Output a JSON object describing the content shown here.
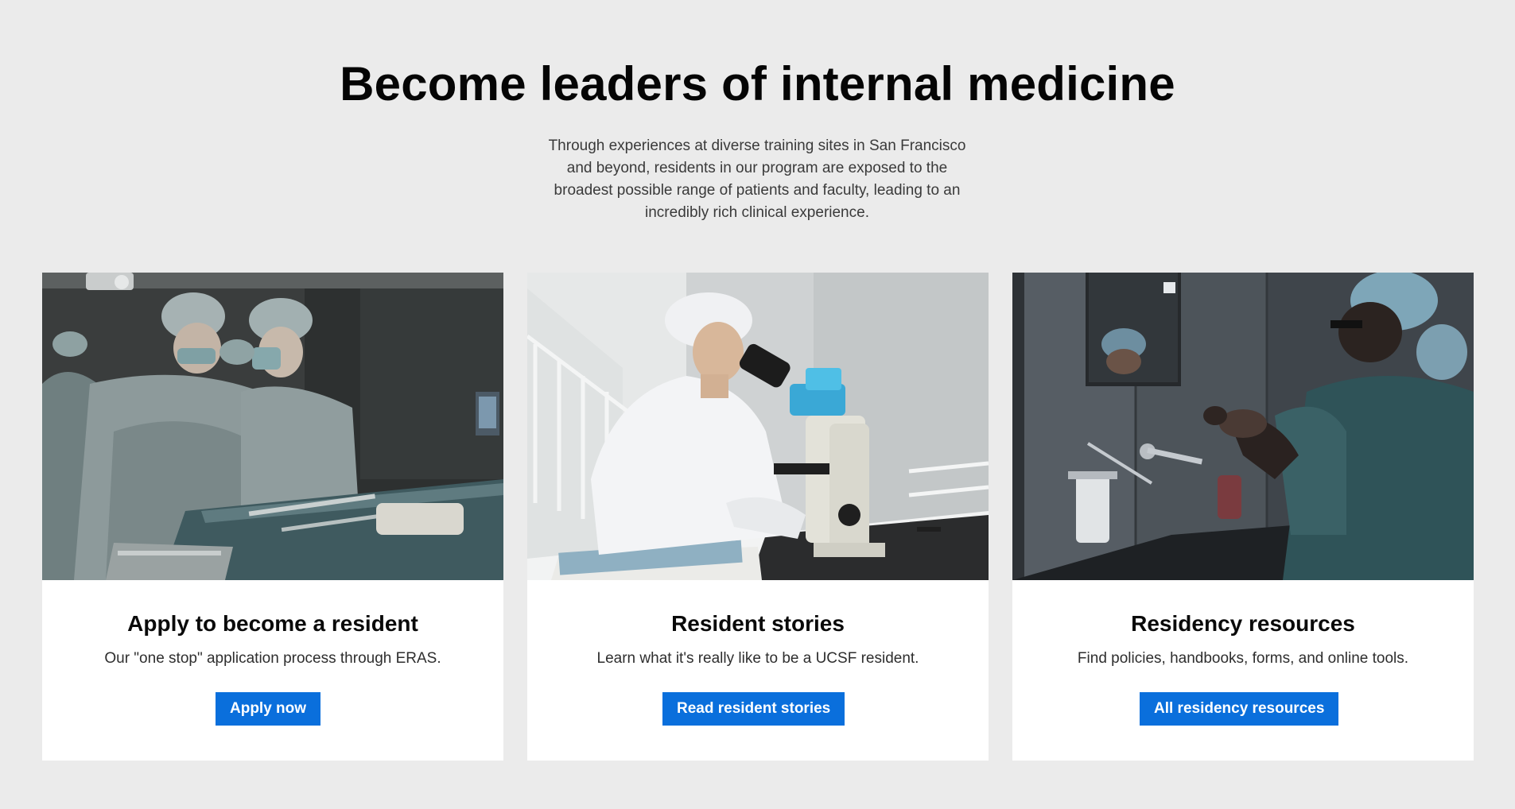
{
  "hero": {
    "title": "Become leaders of internal medicine",
    "intro": "Through experiences at diverse training sites in San Francisco and beyond, residents in our program are exposed to the broadest possible range of patients and faculty, leading to an incredibly rich clinical experience."
  },
  "cards": [
    {
      "title": "Apply to become a resident",
      "text": "Our \"one stop\" application process through ERAS.",
      "button": "Apply now"
    },
    {
      "title": "Resident stories",
      "text": "Learn what it's really like to be a UCSF resident.",
      "button": "Read resident stories"
    },
    {
      "title": "Residency resources",
      "text": "Find policies, handbooks, forms, and online tools.",
      "button": "All residency resources"
    }
  ],
  "colors": {
    "page_background": "#ebebeb",
    "card_background": "#ffffff",
    "button_background": "#0a6fdc",
    "button_text": "#ffffff"
  }
}
